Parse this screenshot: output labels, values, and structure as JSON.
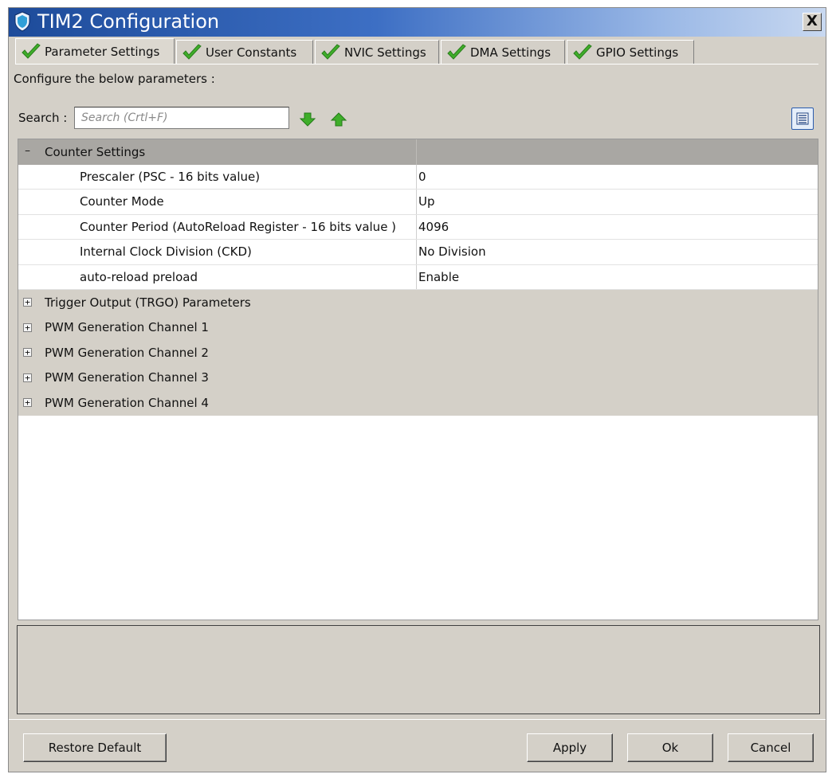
{
  "window": {
    "title": "TIM2 Configuration",
    "close_label": "X"
  },
  "tabs": [
    {
      "label": "Parameter Settings",
      "active": true
    },
    {
      "label": "User Constants",
      "active": false
    },
    {
      "label": "NVIC Settings",
      "active": false
    },
    {
      "label": "DMA Settings",
      "active": false
    },
    {
      "label": "GPIO Settings",
      "active": false
    }
  ],
  "configure_label": "Configure the below parameters :",
  "search": {
    "label": "Search :",
    "placeholder": "Search (Crtl+F)"
  },
  "colors": {
    "check_green": "#3fae2a",
    "title_blue": "#1d4b9a",
    "group_header": "#a9a7a3"
  },
  "tree": {
    "counter_settings": {
      "label": "Counter Settings",
      "toggle": "−",
      "params": [
        {
          "name": "Prescaler (PSC - 16 bits value)",
          "value": "0"
        },
        {
          "name": "Counter Mode",
          "value": "Up"
        },
        {
          "name": "Counter Period (AutoReload Register - 16 bits value )",
          "value": "4096"
        },
        {
          "name": "Internal Clock Division (CKD)",
          "value": "No Division"
        },
        {
          "name": "auto-reload preload",
          "value": "Enable"
        }
      ]
    },
    "groups": [
      {
        "label": "Trigger Output (TRGO) Parameters",
        "toggle": "+"
      },
      {
        "label": "PWM Generation Channel 1",
        "toggle": "+"
      },
      {
        "label": "PWM Generation Channel 2",
        "toggle": "+"
      },
      {
        "label": "PWM Generation Channel 3",
        "toggle": "+"
      },
      {
        "label": "PWM Generation Channel 4",
        "toggle": "+"
      }
    ]
  },
  "buttons": {
    "restore_default": "Restore Default",
    "apply": "Apply",
    "ok": "Ok",
    "cancel": "Cancel"
  }
}
